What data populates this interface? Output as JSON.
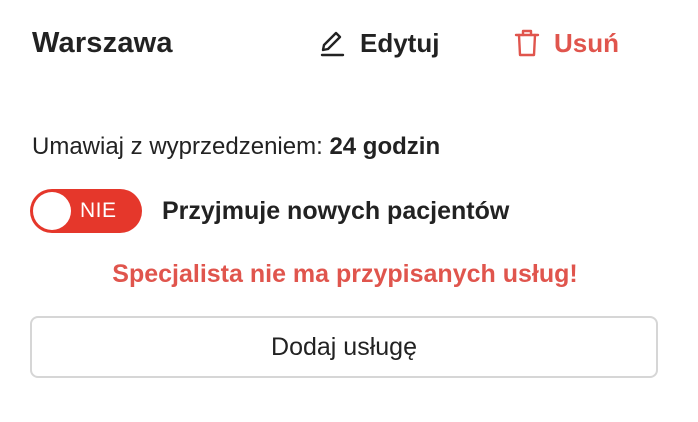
{
  "location": {
    "city": "Warszawa"
  },
  "actions": {
    "edit_label": "Edytuj",
    "edit_icon": "pencil-icon",
    "delete_label": "Usuń",
    "delete_icon": "trash-icon"
  },
  "booking": {
    "advance_label": "Umawiaj z wyprzedzeniem:",
    "advance_value": "24 godzin"
  },
  "accepting_patients": {
    "state_label": "NIE",
    "enabled": false,
    "label": "Przyjmuje nowych pacjentów"
  },
  "services": {
    "warning": "Specjalista nie ma przypisanych usług!",
    "add_button_label": "Dodaj usługę"
  },
  "colors": {
    "danger": "#e0554d",
    "toggle_off": "#e5372b",
    "text": "#222222",
    "button_border": "#d6d6d6"
  }
}
